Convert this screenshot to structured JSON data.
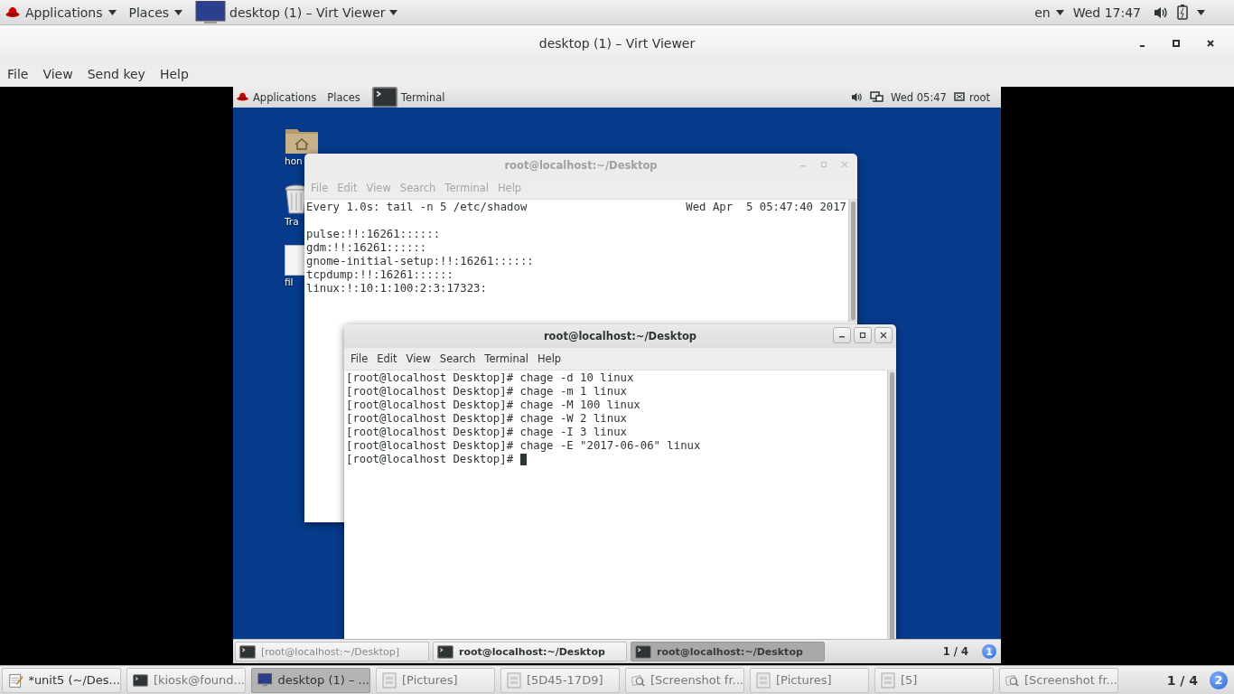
{
  "top_bar": {
    "applications": "Applications",
    "places": "Places",
    "window_label": "desktop (1) – Virt Viewer",
    "language": "en",
    "clock": "Wed 17:47"
  },
  "window": {
    "title": "desktop (1) – Virt Viewer",
    "menu": [
      "File",
      "View",
      "Send key",
      "Help"
    ]
  },
  "guest": {
    "top_bar": {
      "applications": "Applications",
      "places": "Places",
      "window_label": "Terminal",
      "clock": "Wed 05:47",
      "user": "root"
    },
    "desktop_icons": [
      {
        "kind": "home",
        "label": "hon"
      },
      {
        "kind": "trash",
        "label": "Tra"
      },
      {
        "kind": "file",
        "label": "fil"
      }
    ],
    "terminals": [
      {
        "title": "root@localhost:~/Desktop",
        "active": false,
        "menu": [
          "File",
          "Edit",
          "View",
          "Search",
          "Terminal",
          "Help"
        ],
        "header": {
          "command": "Every 1.0s: tail -n 5 /etc/shadow",
          "time": "Wed Apr  5 05:47:40 2017"
        },
        "lines": [
          "pulse:!!:16261::::::",
          "gdm:!!:16261::::::",
          "gnome-initial-setup:!!:16261::::::",
          "tcpdump:!!:16261::::::",
          "linux:!:10:1:100:2:3:17323:"
        ],
        "cursor": false
      },
      {
        "title": "root@localhost:~/Desktop",
        "active": true,
        "menu": [
          "File",
          "Edit",
          "View",
          "Search",
          "Terminal",
          "Help"
        ],
        "lines": [
          "[root@localhost Desktop]# chage -d 10 linux",
          "[root@localhost Desktop]# chage -m 1 linux",
          "[root@localhost Desktop]# chage -M 100 linux",
          "[root@localhost Desktop]# chage -W 2 linux",
          "[root@localhost Desktop]# chage -I 3 linux",
          "[root@localhost Desktop]# chage -E \"2017-06-06\" linux",
          "[root@localhost Desktop]# "
        ],
        "cursor": true
      }
    ],
    "taskbar": {
      "items": [
        {
          "label": "[root@localhost:~/Desktop]",
          "selected": false,
          "minimized": true
        },
        {
          "label": "root@localhost:~/Desktop",
          "selected": false,
          "minimized": false
        },
        {
          "label": "root@localhost:~/Desktop",
          "selected": true,
          "minimized": false
        }
      ],
      "workspace": "1 / 4",
      "notifications": "1"
    }
  },
  "taskbar": {
    "items": [
      {
        "kind": "editor",
        "label": "*unit5 (~/Des...",
        "selected": false
      },
      {
        "kind": "terminal",
        "label": "[kiosk@found...",
        "selected": false
      },
      {
        "kind": "viewer",
        "label": "desktop (1) – ...",
        "selected": true
      },
      {
        "kind": "folder",
        "label": "[Pictures]",
        "selected": false
      },
      {
        "kind": "folder",
        "label": "[5D45-17D9]",
        "selected": false
      },
      {
        "kind": "image",
        "label": "[Screenshot fr...",
        "selected": false
      },
      {
        "kind": "folder",
        "label": "[Pictures]",
        "selected": false
      },
      {
        "kind": "folder",
        "label": "[5]",
        "selected": false
      },
      {
        "kind": "image",
        "label": "[Screenshot fr...",
        "selected": false
      }
    ],
    "workspace": "1 / 4",
    "notifications": "2"
  }
}
